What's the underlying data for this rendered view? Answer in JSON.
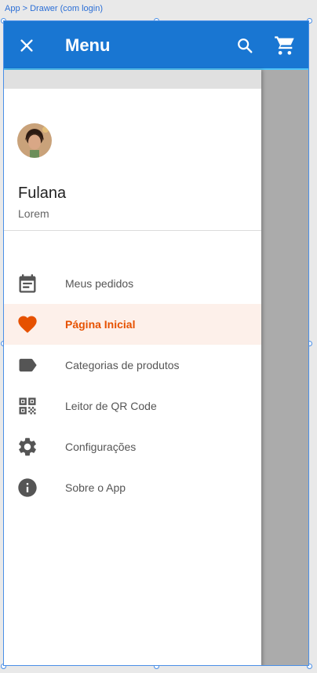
{
  "breadcrumb": "App > Drawer (com login)",
  "appbar": {
    "title": "Menu",
    "color": "#1976d2"
  },
  "user": {
    "name": "Fulana",
    "subtitle": "Lorem"
  },
  "menu": {
    "items": [
      {
        "label": "Meus pedidos",
        "icon": "calendar-icon"
      },
      {
        "label": "Página Inicial",
        "icon": "heart-icon",
        "active": true
      },
      {
        "label": "Categorias de produtos",
        "icon": "label-tag-icon"
      },
      {
        "label": "Leitor de QR Code",
        "icon": "qr-code-icon"
      },
      {
        "label": "Configurações",
        "icon": "gear-icon"
      },
      {
        "label": "Sobre o App",
        "icon": "info-icon"
      }
    ]
  },
  "colors": {
    "accent": "#e65100",
    "active_bg": "#fdf0ea"
  }
}
